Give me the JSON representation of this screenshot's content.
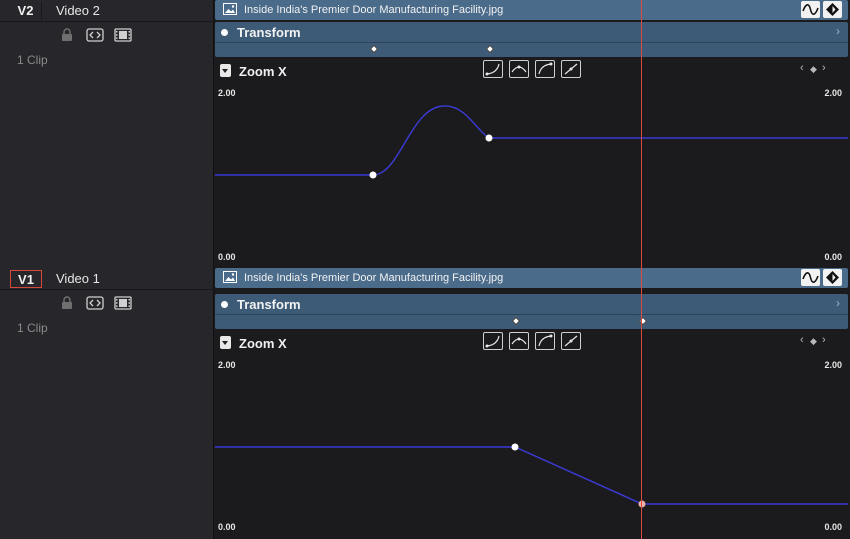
{
  "tracks": [
    {
      "id": "V2",
      "name": "Video 2",
      "clip_count": "1 Clip",
      "active": false,
      "clip_title": "Inside India's Premier Door Manufacturing Facility.jpg",
      "transform_label": "Transform",
      "param_label": "Zoom X",
      "y_max": "2.00",
      "y_min": "0.00",
      "keyframes": [
        {
          "frame_pos": 0.251
        },
        {
          "frame_pos": 0.434
        }
      ],
      "curve_values": [
        0.49,
        0.68
      ]
    },
    {
      "id": "V1",
      "name": "Video 1",
      "clip_count": "1 Clip",
      "active": true,
      "clip_title": "Inside India's Premier Door Manufacturing Facility.jpg",
      "transform_label": "Transform",
      "param_label": "Zoom X",
      "y_max": "2.00",
      "y_min": "0.00",
      "keyframes": [
        {
          "frame_pos": 0.475
        },
        {
          "frame_pos": 0.675
        }
      ],
      "curve_values": [
        0.48,
        0.15
      ]
    }
  ],
  "icons": {
    "lock": "lock-icon",
    "auto_select": "auto-select-icon",
    "disable_track": "filmstrip-icon",
    "image": "image-icon",
    "curve_toggle": "curve-toggle-icon",
    "keyframe_toggle": "keyframe-toggle-icon",
    "curve_buttons": [
      "ease-in-icon",
      "ease-peak-icon",
      "ease-out-icon",
      "linear-icon"
    ],
    "nav_prev": "‹",
    "nav_add": "◆",
    "nav_next": "›"
  },
  "colors": {
    "playhead": "#d84a3f",
    "clip_bar": "#4a6b8a",
    "transform_bar": "#3d5b76",
    "curve": "#3b3bd6",
    "active_track_border": "#d8463c"
  }
}
